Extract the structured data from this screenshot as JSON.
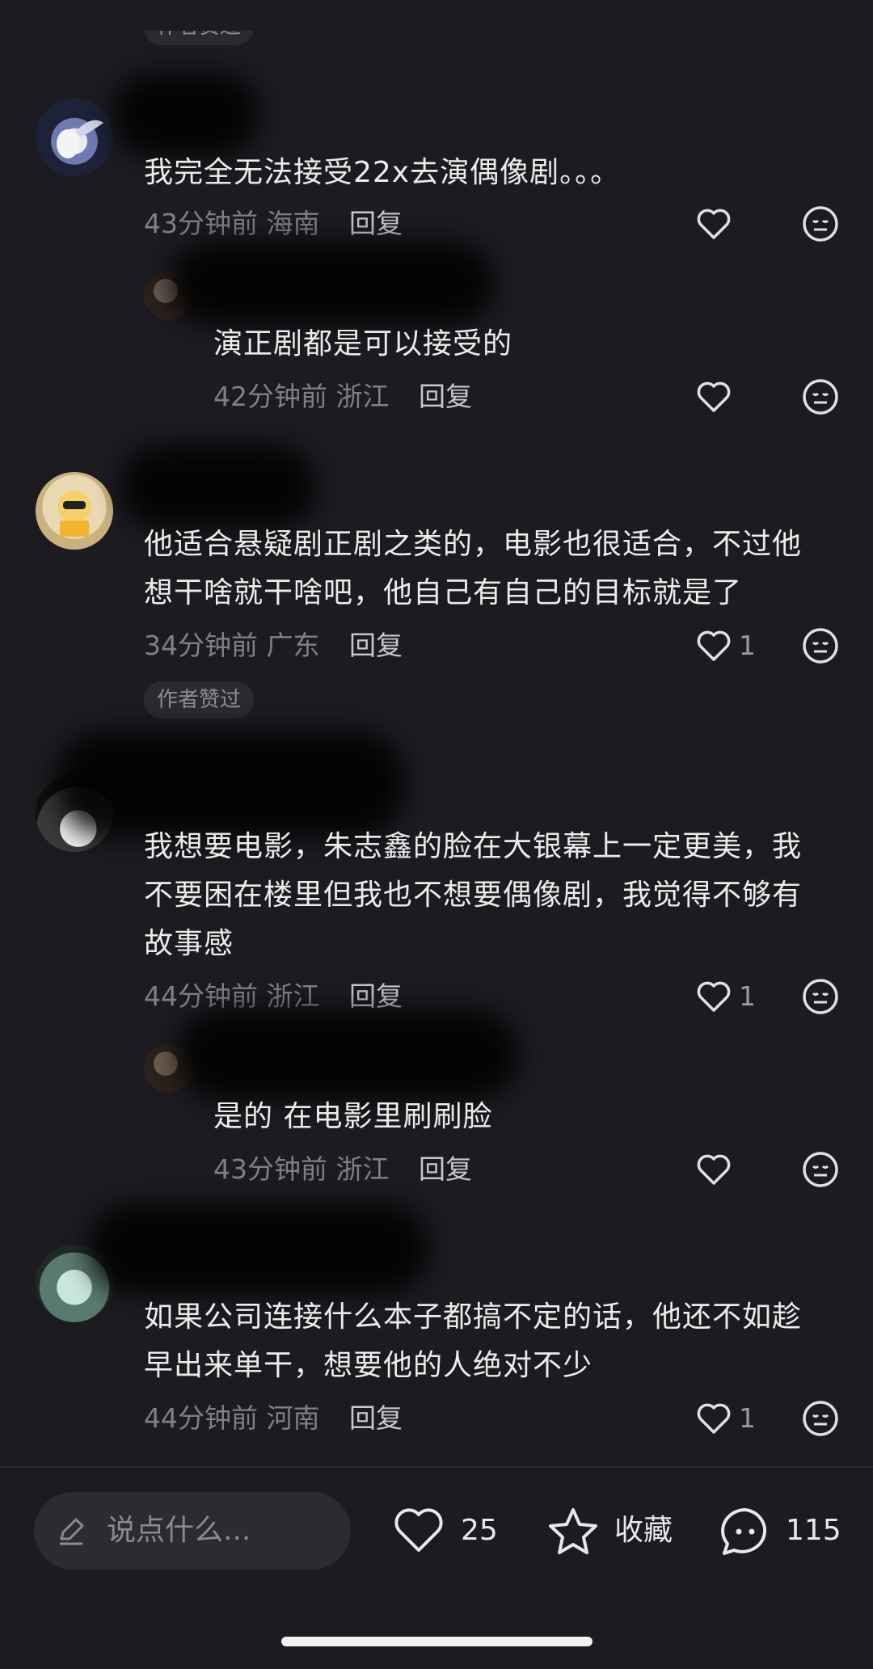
{
  "top_badge": "作者赞过",
  "comments": [
    {
      "text_lines": [
        "我完全无法接受22x去演偶像剧。。。"
      ],
      "time": "43分钟前",
      "region": "海南",
      "reply": "回复",
      "likes": ""
    },
    {
      "is_reply": true,
      "text_lines": [
        "演正剧都是可以接受的"
      ],
      "time": "42分钟前",
      "region": "浙江",
      "reply": "回复",
      "likes": ""
    },
    {
      "text_lines": [
        "他适合悬疑剧正剧之类的，电影也很适合，不过他",
        "想干啥就干啥吧，他自己有自己的目标就是了"
      ],
      "time": "34分钟前",
      "region": "广东",
      "reply": "回复",
      "likes": "1",
      "badge": "作者赞过"
    },
    {
      "text_lines": [
        "我想要电影，朱志鑫的脸在大银幕上一定更美，我",
        "不要困在楼里但我也不想要偶像剧，我觉得不够有",
        "故事感"
      ],
      "time": "44分钟前",
      "region": "浙江",
      "reply": "回复",
      "likes": "1"
    },
    {
      "is_reply": true,
      "text_lines": [
        "是的 在电影里刷刷脸"
      ],
      "time": "43分钟前",
      "region": "浙江",
      "reply": "回复",
      "likes": ""
    },
    {
      "text_lines": [
        "如果公司连接什么本子都搞不定的话，他还不如趁",
        "早出来单干，想要他的人绝对不少"
      ],
      "time": "44分钟前",
      "region": "河南",
      "reply": "回复",
      "likes": "1"
    }
  ],
  "bottom_bar": {
    "input_placeholder": "说点什么...",
    "like_count": "25",
    "collect_label": "收藏",
    "comment_count": "115",
    "icons": [
      "pencil-icon",
      "heart-icon",
      "star-icon",
      "chat-bubble-icon"
    ]
  },
  "colors": {
    "background": "#1b1b20",
    "text": "#ececec",
    "meta": "#7f7f86"
  }
}
